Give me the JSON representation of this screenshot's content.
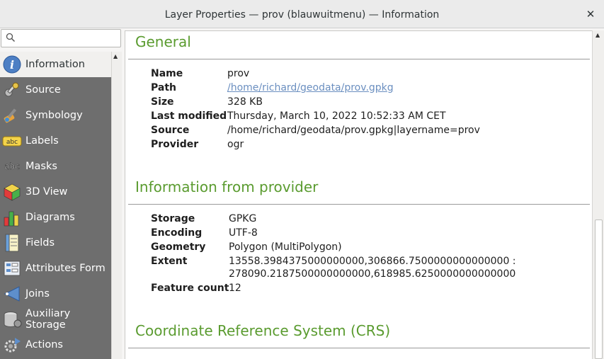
{
  "window": {
    "title": "Layer Properties — prov (blauwuitmenu) — Information",
    "close_glyph": "✕"
  },
  "search": {
    "placeholder": "",
    "value": ""
  },
  "sidebar": {
    "items": [
      {
        "label": "Information",
        "icon": "info-icon",
        "active": true
      },
      {
        "label": "Source",
        "icon": "source-wrench-icon"
      },
      {
        "label": "Symbology",
        "icon": "symbology-brush-icon"
      },
      {
        "label": "Labels",
        "icon": "labels-abc-icon"
      },
      {
        "label": "Masks",
        "icon": "masks-abc-icon"
      },
      {
        "label": "3D View",
        "icon": "3d-cube-icon"
      },
      {
        "label": "Diagrams",
        "icon": "diagrams-icon"
      },
      {
        "label": "Fields",
        "icon": "fields-icon"
      },
      {
        "label": "Attributes Form",
        "icon": "attributes-form-icon"
      },
      {
        "label": "Joins",
        "icon": "joins-icon"
      },
      {
        "label": "Auxiliary Storage",
        "icon": "auxiliary-storage-icon"
      },
      {
        "label": "Actions",
        "icon": "actions-gear-icon"
      }
    ]
  },
  "general": {
    "heading": "General",
    "rows": [
      {
        "key": "Name",
        "value": "prov"
      },
      {
        "key": "Path",
        "value": "/home/richard/geodata/prov.gpkg"
      },
      {
        "key": "Size",
        "value": "328 KB"
      },
      {
        "key": "Last modified",
        "value": "Thursday, March 10, 2022 10:52:33 AM CET"
      },
      {
        "key": "Source",
        "value": "/home/richard/geodata/prov.gpkg|layername=prov"
      },
      {
        "key": "Provider",
        "value": "ogr"
      }
    ]
  },
  "provider": {
    "heading": "Information from provider",
    "rows": [
      {
        "key": "Storage",
        "value": "GPKG"
      },
      {
        "key": "Encoding",
        "value": "UTF-8"
      },
      {
        "key": "Geometry",
        "value": "Polygon (MultiPolygon)"
      },
      {
        "key": "Extent",
        "value": "13558.3984375000000000,306866.7500000000000000 :",
        "value2": "278090.2187500000000000,618985.6250000000000000"
      },
      {
        "key": "Feature count",
        "value": "12"
      }
    ]
  },
  "crs": {
    "heading": "Coordinate Reference System (CRS)"
  },
  "colors": {
    "heading": "#5a9b2f",
    "sidebar": "#6e6e6e",
    "link": "#6b8fc0"
  }
}
